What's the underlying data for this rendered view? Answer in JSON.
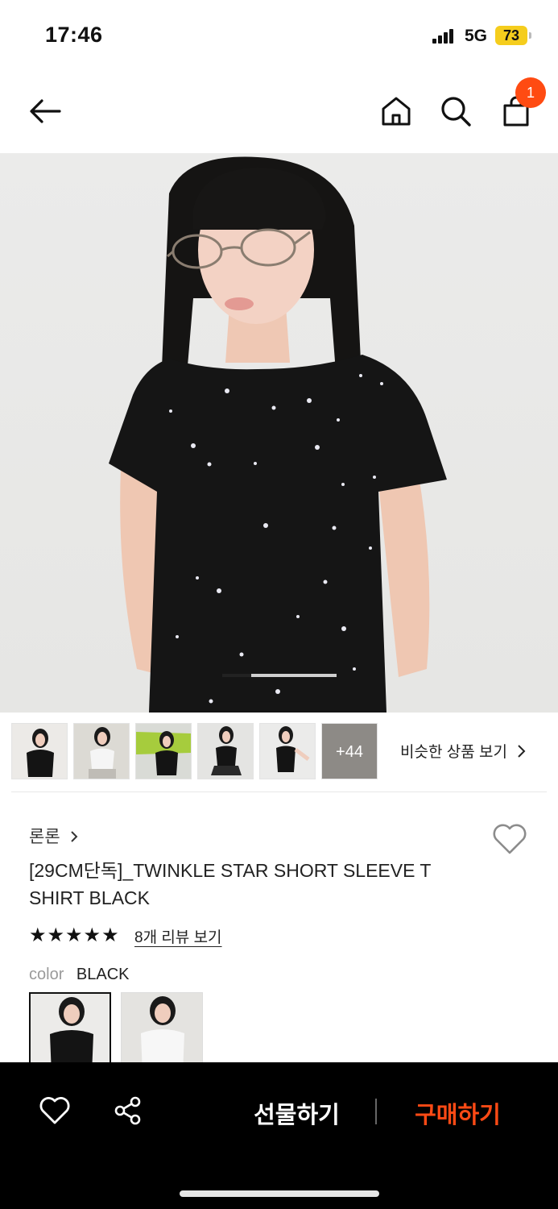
{
  "status_bar": {
    "time": "17:46",
    "network": "5G",
    "battery": "73"
  },
  "nav": {
    "icons": [
      "back-arrow-icon",
      "home-icon",
      "search-icon",
      "shopping-bag-icon"
    ],
    "cart_count": "1"
  },
  "gallery": {
    "progress_fraction": 0.25
  },
  "thumbnails": {
    "more_count": "+44",
    "similar_label": "비슷한 상품 보기"
  },
  "product": {
    "brand": "론론",
    "title": "[29CM단독]_TWINKLE STAR SHORT SLEEVE T SHIRT BLACK",
    "stars": "★★★★★",
    "rating": 5,
    "review_link": "8개 리뷰 보기",
    "color_label": "color",
    "color_value": "BLACK"
  },
  "bottom_bar": {
    "gift_label": "선물하기",
    "buy_label": "구매하기"
  },
  "colors": {
    "accent": "#ff4b12",
    "battery": "#f5cd1d",
    "bar_bg": "#000000"
  }
}
